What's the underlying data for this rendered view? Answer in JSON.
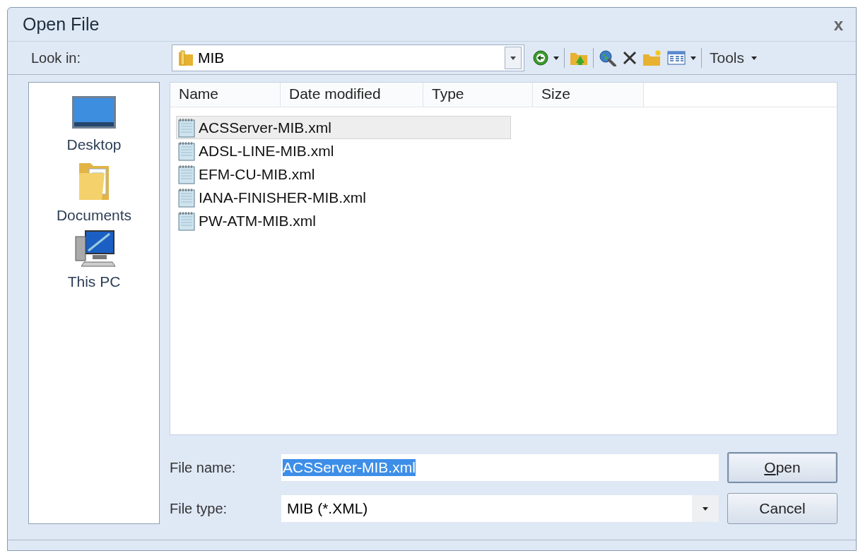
{
  "window": {
    "title": "Open File",
    "close": "x"
  },
  "toolbar": {
    "look_in_label": "Look in:",
    "look_in_value": "MIB",
    "tools_label": "Tools"
  },
  "places": [
    {
      "kind": "desktop",
      "label": "Desktop"
    },
    {
      "kind": "documents",
      "label": "Documents"
    },
    {
      "kind": "computer",
      "label": "This PC"
    }
  ],
  "columns": [
    "Name",
    "Date modified",
    "Type",
    "Size"
  ],
  "files": [
    {
      "name": "ACSServer-MIB.xml",
      "selected": true
    },
    {
      "name": "ADSL-LINE-MIB.xml",
      "selected": false
    },
    {
      "name": "EFM-CU-MIB.xml",
      "selected": false
    },
    {
      "name": "IANA-FINISHER-MIB.xml",
      "selected": false
    },
    {
      "name": "PW-ATM-MIB.xml",
      "selected": false
    }
  ],
  "file_name": {
    "label": "File name:",
    "value": "ACSServer-MIB.xml",
    "text_selected": true
  },
  "file_type": {
    "label": "File type:",
    "value": "MIB (*.XML)"
  },
  "buttons": [
    {
      "label": "Open",
      "default": true,
      "access_key_first": true
    },
    {
      "label": "Cancel",
      "default": false,
      "access_key_first": false
    }
  ]
}
